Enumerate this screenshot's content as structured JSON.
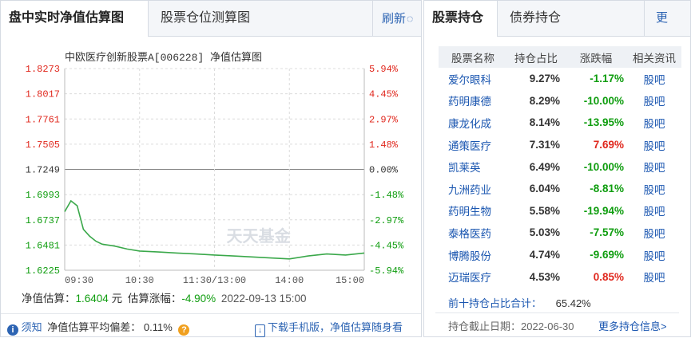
{
  "left": {
    "tab_active": "盘中实时净值估算图",
    "tab_inactive": "股票仓位测算图",
    "refresh_label": "刷新",
    "chart_data": {
      "type": "line",
      "title": "中欧医疗创新股票A[006228] 净值估算图",
      "yticks": [
        "1.8273",
        "1.8017",
        "1.7761",
        "1.7505",
        "1.7249",
        "1.6993",
        "1.6737",
        "1.6481",
        "1.6225"
      ],
      "yticks_right": [
        "5.94%",
        "4.45%",
        "2.97%",
        "1.48%",
        "0.00%",
        "-1.48%",
        "-2.97%",
        "-4.45%",
        "-5.94%"
      ],
      "xticks": [
        "09:30",
        "10:30",
        "11:30/13:00",
        "14:00",
        "15:00"
      ],
      "ylim": [
        1.6225,
        1.8273
      ],
      "baseline": 1.7249,
      "x": [
        "09:30",
        "09:35",
        "09:40",
        "09:45",
        "09:50",
        "09:55",
        "10:00",
        "10:10",
        "10:20",
        "10:30",
        "10:45",
        "11:00",
        "11:15",
        "11:30",
        "13:15",
        "13:30",
        "13:45",
        "14:00",
        "14:15",
        "14:30",
        "14:45",
        "15:00"
      ],
      "values": [
        1.682,
        1.693,
        1.688,
        1.664,
        1.657,
        1.652,
        1.649,
        1.647,
        1.644,
        1.642,
        1.641,
        1.64,
        1.639,
        1.638,
        1.637,
        1.636,
        1.635,
        1.634,
        1.637,
        1.639,
        1.638,
        1.64
      ],
      "colors": {
        "line": "#3aa84a",
        "pos": "#e0281e",
        "neg": "#0f9d0f",
        "grid": "#dcdcdc"
      }
    },
    "watermark": "天天基金",
    "estimate_label": "净值估算：",
    "estimate_value": "1.6404",
    "estimate_unit": "元",
    "change_label": "估算涨幅：",
    "change_value": "-4.90%",
    "datetime": "2022-09-13 15:00",
    "notice_label": "须知",
    "deviation_label": "净值估算平均偏差：",
    "deviation_value": "0.11%",
    "download_text": "下载手机版，净值估算随身看"
  },
  "right": {
    "tab_active": "股票持仓",
    "tab_inactive": "债券持仓",
    "more_label": "更多",
    "columns": [
      "股票名称",
      "持仓占比",
      "涨跌幅",
      "相关资讯"
    ],
    "rows": [
      {
        "name": "爱尔眼科",
        "ratio": "9.27%",
        "change": "-1.17%",
        "dir": "neg",
        "link": "股吧"
      },
      {
        "name": "药明康德",
        "ratio": "8.29%",
        "change": "-10.00%",
        "dir": "neg",
        "link": "股吧"
      },
      {
        "name": "康龙化成",
        "ratio": "8.14%",
        "change": "-13.95%",
        "dir": "neg",
        "link": "股吧"
      },
      {
        "name": "通策医疗",
        "ratio": "7.31%",
        "change": "7.69%",
        "dir": "pos",
        "link": "股吧"
      },
      {
        "name": "凯莱英",
        "ratio": "6.49%",
        "change": "-10.00%",
        "dir": "neg",
        "link": "股吧"
      },
      {
        "name": "九洲药业",
        "ratio": "6.04%",
        "change": "-8.81%",
        "dir": "neg",
        "link": "股吧"
      },
      {
        "name": "药明生物",
        "ratio": "5.58%",
        "change": "-19.94%",
        "dir": "neg",
        "link": "股吧"
      },
      {
        "name": "泰格医药",
        "ratio": "5.03%",
        "change": "-7.57%",
        "dir": "neg",
        "link": "股吧"
      },
      {
        "name": "博腾股份",
        "ratio": "4.74%",
        "change": "-9.69%",
        "dir": "neg",
        "link": "股吧"
      },
      {
        "name": "迈瑞医疗",
        "ratio": "4.53%",
        "change": "0.85%",
        "dir": "pos",
        "link": "股吧"
      }
    ],
    "top10_label": "前十持仓占比合计：",
    "top10_value": "65.42%",
    "date_label": "持仓截止日期：",
    "date_value": "2022-06-30",
    "more_holdings": "更多持仓信息>"
  }
}
